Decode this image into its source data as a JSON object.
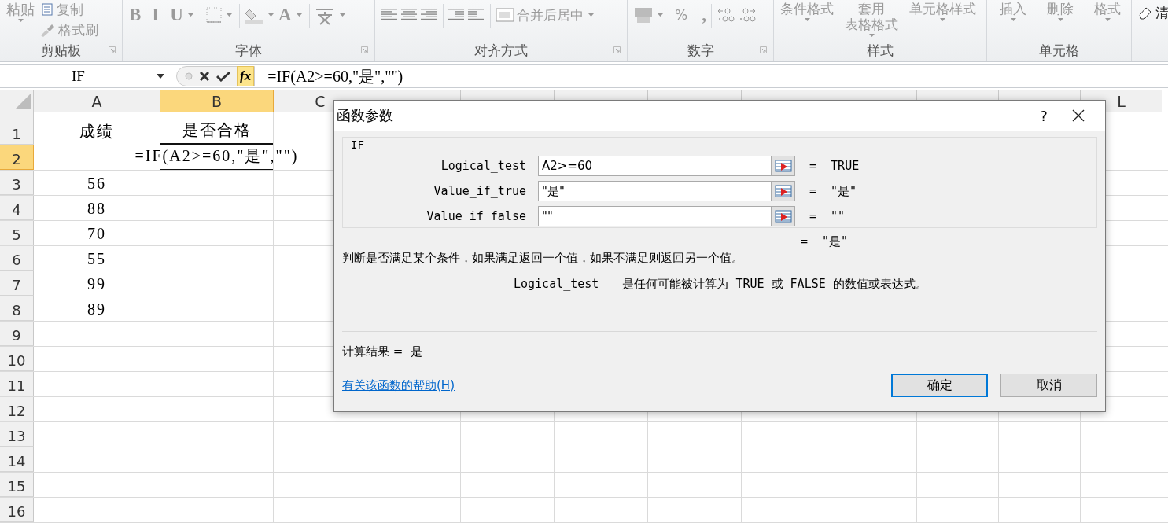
{
  "ribbon": {
    "groups": [
      {
        "kind": "clipboard",
        "label": "剪贴板",
        "disabled": true,
        "items": [
          {
            "label": "粘贴"
          },
          {
            "label": "复制"
          },
          {
            "label": "格式刷"
          }
        ]
      },
      {
        "kind": "font",
        "label": "字体",
        "disabled": true,
        "items": [
          {
            "label": "B"
          },
          {
            "label": "I"
          },
          {
            "label": "U"
          },
          {
            "label": "A"
          }
        ]
      },
      {
        "kind": "alignment",
        "label": "对齐方式",
        "disabled": true,
        "items": [
          {
            "label": "合并后居中"
          }
        ]
      },
      {
        "kind": "number",
        "label": "数字",
        "disabled": true,
        "items": [
          {
            "label": "%"
          },
          {
            "label": ","
          }
        ]
      },
      {
        "kind": "styles",
        "label": "样式",
        "disabled": true,
        "items": [
          {
            "lines": [
              "条件格式"
            ]
          },
          {
            "lines": [
              "套用",
              "表格格式"
            ]
          },
          {
            "lines": [
              "单元格样式"
            ]
          }
        ]
      },
      {
        "kind": "cells",
        "label": "单元格",
        "disabled": true,
        "items": [
          {
            "lines": [
              "插入"
            ]
          },
          {
            "lines": [
              "删除"
            ]
          },
          {
            "lines": [
              "格式"
            ]
          }
        ]
      },
      {
        "kind": "editing",
        "disabled": false,
        "items": [
          {
            "label": "清"
          }
        ]
      }
    ]
  },
  "formula_bar": {
    "name_box": "IF",
    "function_button": "fx",
    "formula": "=IF(A2>=60,\"是\",\"\")"
  },
  "sheet": {
    "columns": [
      {
        "label": "A",
        "selected": false
      },
      {
        "label": "B",
        "selected": true
      },
      {
        "label": "C",
        "selected": false
      },
      {
        "selected": false
      },
      {
        "selected": false
      },
      {
        "selected": false
      },
      {
        "selected": false
      },
      {
        "selected": false
      },
      {
        "selected": false
      },
      {
        "selected": false
      },
      {
        "selected": false
      },
      {
        "label": "L",
        "selected": false
      }
    ],
    "rows": [
      {
        "label": "1",
        "selected": false,
        "cells": [
          {
            "text": "成绩",
            "underlined": false
          },
          {
            "text": "是否合格",
            "underlined": true
          }
        ]
      },
      {
        "label": "2",
        "selected": true,
        "cells": [
          {
            "text": ""
          },
          {
            "text": "=IF(A2>=60,\"是\",\"\")",
            "underlined": true
          }
        ]
      },
      {
        "label": "3",
        "selected": false,
        "cells": [
          {
            "text": "56",
            "underlined": false
          }
        ]
      },
      {
        "label": "4",
        "selected": false,
        "cells": [
          {
            "text": "88",
            "underlined": false
          }
        ]
      },
      {
        "label": "5",
        "selected": false,
        "cells": [
          {
            "text": "70",
            "underlined": false
          }
        ]
      },
      {
        "label": "6",
        "selected": false,
        "cells": [
          {
            "text": "55",
            "underlined": false
          }
        ]
      },
      {
        "label": "7",
        "selected": false,
        "cells": [
          {
            "text": "99",
            "underlined": false
          }
        ]
      },
      {
        "label": "8",
        "selected": false,
        "cells": [
          {
            "text": "89",
            "underlined": false
          }
        ]
      },
      {
        "label": "9",
        "selected": false,
        "cells": []
      },
      {
        "label": "10",
        "selected": false,
        "cells": []
      },
      {
        "label": "11",
        "selected": false,
        "cells": []
      },
      {
        "label": "12",
        "selected": false,
        "cells": []
      },
      {
        "label": "13",
        "selected": false,
        "cells": []
      },
      {
        "label": "14",
        "selected": false,
        "cells": []
      },
      {
        "label": "15",
        "selected": false,
        "cells": []
      },
      {
        "label": "16",
        "selected": false,
        "cells": []
      }
    ]
  },
  "dialog": {
    "title": "函数参数",
    "help": "?",
    "function": "IF",
    "arguments": [
      {
        "name": "Logical_test",
        "value": "A2>=60",
        "result": "=  TRUE"
      },
      {
        "name": "Value_if_true",
        "value": "\"是\"",
        "result": "=  \"是\""
      },
      {
        "name": "Value_if_false",
        "value": "\"\"",
        "result": "=  \"\""
      }
    ],
    "formula_result": "=  \"是\"",
    "description": "判断是否满足某个条件，如果满足返回一个值，如果不满足则返回另一个值。",
    "argument_help": {
      "name": "Logical_test",
      "text": "是任何可能被计算为 TRUE 或 FALSE 的数值或表达式。"
    },
    "calc_result": "计算结果 =  是",
    "help_link": "有关该函数的帮助(H)",
    "buttons": [
      {
        "label": "确定",
        "selected": true
      },
      {
        "label": "取消",
        "selected": false
      }
    ]
  }
}
